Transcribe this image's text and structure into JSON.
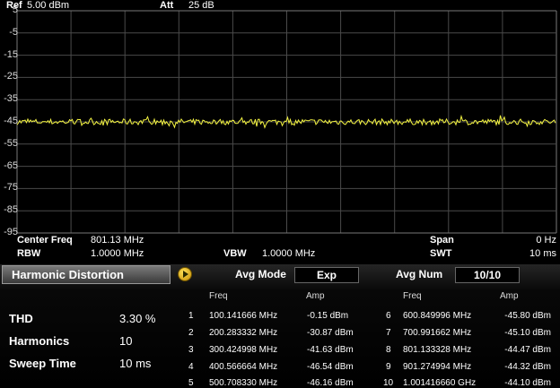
{
  "header": {
    "ref_label": "Ref",
    "ref_value": "5.00 dBm",
    "att_label": "Att",
    "att_value": "25 dB"
  },
  "y_ticks": [
    "5",
    "-5",
    "-15",
    "-25",
    "-35",
    "-45",
    "-55",
    "-65",
    "-75",
    "-85",
    "-95"
  ],
  "footer": {
    "center_freq_label": "Center Freq",
    "center_freq_value": "801.13 MHz",
    "rbw_label": "RBW",
    "rbw_value": "1.0000 MHz",
    "vbw_label": "VBW",
    "vbw_value": "1.0000 MHz",
    "span_label": "Span",
    "span_value": "0 Hz",
    "swt_label": "SWT",
    "swt_value": "10 ms"
  },
  "trace": {
    "level_dbm": -45,
    "color": "#f5f542",
    "ylim": [
      -95,
      5
    ]
  },
  "panel": {
    "title": "Harmonic Distortion",
    "avg_mode_label": "Avg Mode",
    "avg_mode_value": "Exp",
    "avg_num_label": "Avg Num",
    "avg_num_value": "10/10"
  },
  "summary": {
    "thd_label": "THD",
    "thd_value": "3.30 %",
    "harmonics_label": "Harmonics",
    "harmonics_value": "10",
    "sweep_label": "Sweep Time",
    "sweep_value": "10 ms"
  },
  "columns": {
    "freq": "Freq",
    "amp": "Amp"
  },
  "harmonics_left": [
    {
      "n": "1",
      "freq": "100.141666 MHz",
      "amp": "-0.15 dBm"
    },
    {
      "n": "2",
      "freq": "200.283332 MHz",
      "amp": "-30.87 dBm"
    },
    {
      "n": "3",
      "freq": "300.424998 MHz",
      "amp": "-41.63 dBm"
    },
    {
      "n": "4",
      "freq": "400.566664 MHz",
      "amp": "-46.54 dBm"
    },
    {
      "n": "5",
      "freq": "500.708330 MHz",
      "amp": "-46.16 dBm"
    }
  ],
  "harmonics_right": [
    {
      "n": "6",
      "freq": "600.849996 MHz",
      "amp": "-45.80 dBm"
    },
    {
      "n": "7",
      "freq": "700.991662 MHz",
      "amp": "-45.10 dBm"
    },
    {
      "n": "8",
      "freq": "801.133328 MHz",
      "amp": "-44.47 dBm"
    },
    {
      "n": "9",
      "freq": "901.274994 MHz",
      "amp": "-44.32 dBm"
    },
    {
      "n": "10",
      "freq": "1.001416660 GHz",
      "amp": "-44.10 dBm"
    }
  ]
}
